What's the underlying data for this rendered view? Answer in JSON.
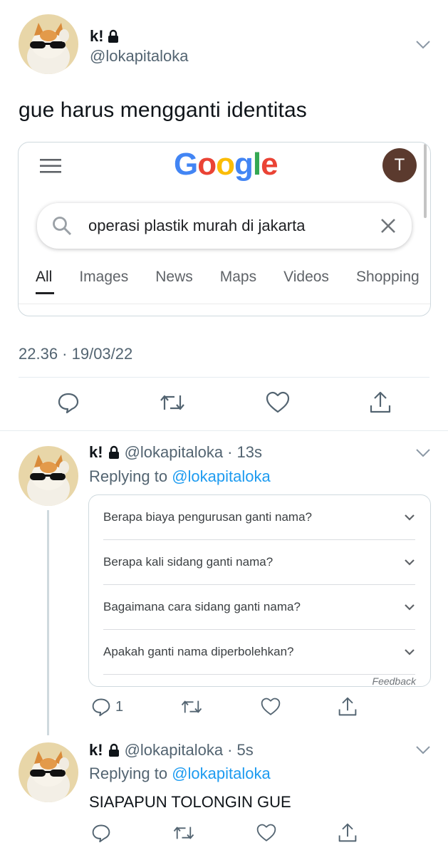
{
  "main_tweet": {
    "display_name": "k!",
    "handle": "@lokapitaloka",
    "text": "gue harus mengganti identitas",
    "timestamp": "22.36 · 19/03/22",
    "google": {
      "logo": "Google",
      "avatar_letter": "T",
      "search_query": "operasi plastik murah di jakarta",
      "tabs": [
        "All",
        "Images",
        "News",
        "Maps",
        "Videos",
        "Shopping"
      ],
      "active_tab": "All"
    }
  },
  "reply1": {
    "display_name": "k!",
    "handle": "@lokapitaloka",
    "time": "· 13s",
    "replying_label": "Replying to",
    "replying_to": "@lokapitaloka",
    "faq": [
      "Berapa biaya pengurusan ganti nama?",
      "Berapa kali sidang ganti nama?",
      "Bagaimana cara sidang ganti nama?",
      "Apakah ganti nama diperbolehkan?"
    ],
    "feedback": "Feedback",
    "reply_count": "1"
  },
  "reply2": {
    "display_name": "k!",
    "handle": "@lokapitaloka",
    "time": "· 5s",
    "replying_label": "Replying to",
    "replying_to": "@lokapitaloka",
    "text": "SIAPAPUN TOLONGIN GUE"
  },
  "icons": {
    "lock": "lock-icon",
    "chevron": "chevron-down-icon",
    "reply": "reply-icon",
    "retweet": "retweet-icon",
    "like": "heart-icon",
    "share": "share-icon",
    "search": "search-icon",
    "clear": "close-icon",
    "menu": "hamburger-menu-icon"
  },
  "colors": {
    "link": "#1d9bf0",
    "muted": "#536471",
    "google_blue": "#4285f4",
    "google_red": "#ea4335",
    "google_yellow": "#fbbc05",
    "google_green": "#34a853",
    "avatar_t_bg": "#5b3a2e"
  }
}
